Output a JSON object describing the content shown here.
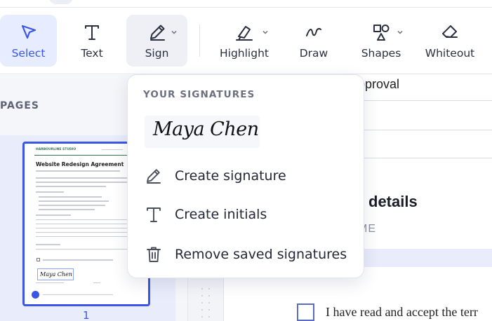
{
  "toolbar": {
    "tools": [
      {
        "label": "Select"
      },
      {
        "label": "Text"
      },
      {
        "label": "Sign"
      },
      {
        "label": "Highlight"
      },
      {
        "label": "Draw"
      },
      {
        "label": "Shapes"
      },
      {
        "label": "Whiteout"
      }
    ]
  },
  "sidebar": {
    "title": "PAGES",
    "thumbnail": {
      "brand": "HARBOURLINE STUDIO",
      "heading": "Website Redesign Agreement",
      "signature": "Maya Chen",
      "page_number": "1"
    }
  },
  "document": {
    "approval_text": "pproval",
    "section_heading": "details",
    "field_label": "ME",
    "accept_text": "I have read and accept the terr"
  },
  "signature_menu": {
    "title": "YOUR SIGNATURES",
    "saved_signature": "Maya Chen",
    "items": [
      {
        "label": "Create signature",
        "icon": "pen-icon"
      },
      {
        "label": "Create initials",
        "icon": "text-t-icon"
      },
      {
        "label": "Remove saved signatures",
        "icon": "trash-icon"
      }
    ]
  },
  "colors": {
    "accent": "#3b55e6",
    "active_bg": "#e7edff",
    "text": "#232838"
  }
}
